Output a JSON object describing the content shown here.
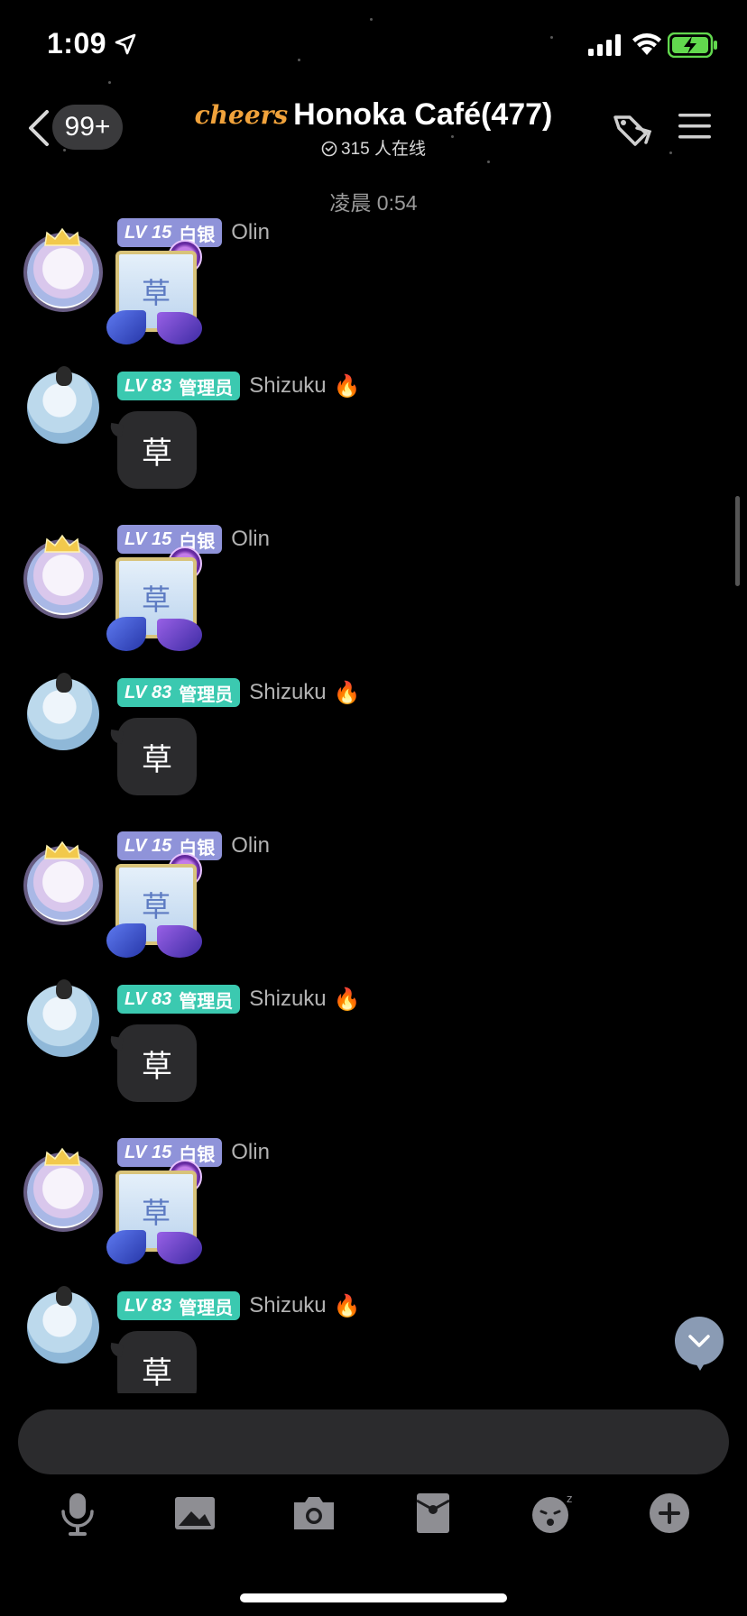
{
  "status_bar": {
    "time": "1:09"
  },
  "header": {
    "unread_count": "99+",
    "logo_text": "cheers",
    "title": "Honoka Café(477)",
    "online_text": "315 人在线"
  },
  "chat": {
    "timestamp": "凌晨 0:54",
    "messages": [
      {
        "user": "Olin",
        "level": "LV 15",
        "rank": "白银",
        "type": "sticker",
        "content": "草"
      },
      {
        "user": "Shizuku",
        "level": "LV 83",
        "rank": "管理员",
        "type": "text",
        "content": "草"
      },
      {
        "user": "Olin",
        "level": "LV 15",
        "rank": "白银",
        "type": "sticker",
        "content": "草"
      },
      {
        "user": "Shizuku",
        "level": "LV 83",
        "rank": "管理员",
        "type": "text",
        "content": "草"
      },
      {
        "user": "Olin",
        "level": "LV 15",
        "rank": "白银",
        "type": "sticker",
        "content": "草"
      },
      {
        "user": "Shizuku",
        "level": "LV 83",
        "rank": "管理员",
        "type": "text",
        "content": "草"
      },
      {
        "user": "Olin",
        "level": "LV 15",
        "rank": "白银",
        "type": "sticker",
        "content": "草"
      },
      {
        "user": "Shizuku",
        "level": "LV 83",
        "rank": "管理员",
        "type": "text",
        "content": "草"
      }
    ]
  },
  "input": {
    "placeholder": ""
  },
  "toolbar": [
    "microphone-icon",
    "image-icon",
    "camera-icon",
    "red-packet-icon",
    "sticker-icon",
    "plus-icon"
  ],
  "colors": {
    "background": "#000000",
    "bubble": "#2b2b2d",
    "lv_olin": "#8f93d9",
    "lv_shizuku": "#3bc9b0",
    "battery": "#62d84e",
    "logo": "#f0a23b"
  }
}
